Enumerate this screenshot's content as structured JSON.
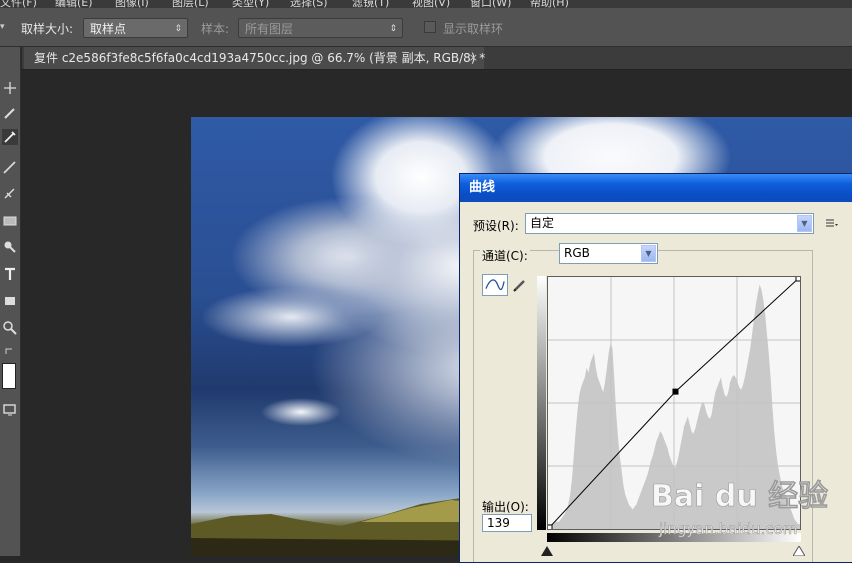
{
  "menubar": {
    "items": [
      "文件(F)",
      "编辑(E)",
      "图像(I)",
      "图层(L)",
      "类型(Y)",
      "选择(S)",
      "滤镜(T)",
      "视图(V)",
      "窗口(W)",
      "帮助(H)"
    ]
  },
  "options": {
    "sample_size_label": "取样大小:",
    "sample_size_value": "取样点",
    "sample_label": "样本:",
    "sample_value": "所有图层",
    "show_ring_label": "显示取样环"
  },
  "document": {
    "tab_title": "复件 c2e586f3fe8c5f6fa0c4cd193a4750cc.jpg @ 66.7% (背景 副本, RGB/8) *",
    "close": "×"
  },
  "curves_dialog": {
    "title": "曲线",
    "preset_label": "预设(R):",
    "preset_value": "自定",
    "channel_label": "通道(C):",
    "channel_value": "RGB",
    "output_label": "输出(O):",
    "output_value": "139",
    "control_point": {
      "input": 129,
      "output": 139
    },
    "histogram": [
      2,
      2,
      2,
      2,
      3,
      3,
      3,
      4,
      5,
      6,
      8,
      10,
      14,
      20,
      30,
      40,
      48,
      55,
      58,
      60,
      62,
      66,
      64,
      68,
      70,
      72,
      66,
      62,
      60,
      58,
      56,
      60,
      66,
      72,
      76,
      74,
      62,
      48,
      38,
      30,
      24,
      18,
      14,
      12,
      10,
      9,
      8,
      9,
      10,
      12,
      14,
      16,
      18,
      20,
      22,
      25,
      28,
      30,
      33,
      36,
      38,
      40,
      39,
      37,
      35,
      33,
      30,
      28,
      26,
      25,
      27,
      30,
      34,
      38,
      42,
      44,
      46,
      43,
      40,
      39,
      41,
      44,
      47,
      50,
      52,
      51,
      48,
      46,
      45,
      47,
      52,
      56,
      58,
      60,
      62,
      58,
      55,
      54,
      56,
      60,
      62,
      63,
      62,
      60,
      58,
      57,
      59,
      62,
      66,
      70,
      74,
      80,
      86,
      92,
      96,
      100,
      98,
      94,
      88,
      80,
      72,
      62,
      50,
      40,
      32,
      26,
      22,
      18,
      16,
      14,
      12,
      10,
      8,
      6,
      4,
      3,
      2,
      2
    ]
  },
  "watermark": {
    "brand": "Bai du 经验",
    "url": "jingyan.baidu.com"
  }
}
